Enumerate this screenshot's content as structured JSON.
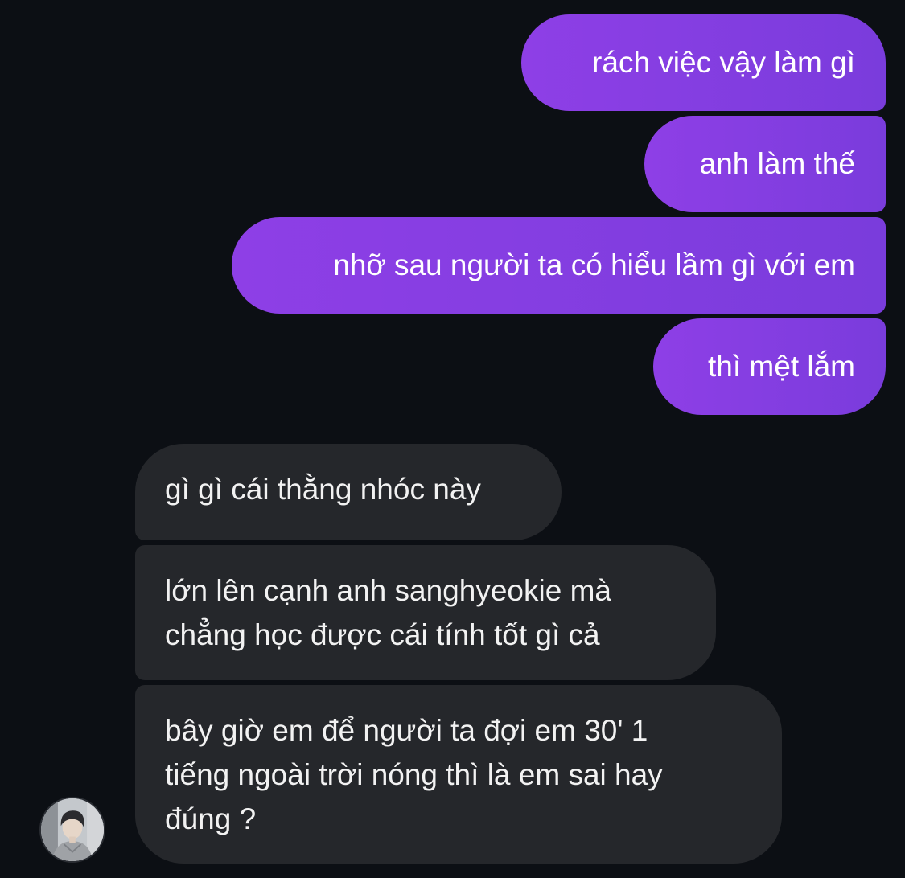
{
  "conversation": {
    "messages": [
      {
        "sender": "me",
        "text": "rách việc vậy làm gì"
      },
      {
        "sender": "me",
        "text": "anh làm thế"
      },
      {
        "sender": "me",
        "text": "nhỡ sau người ta có hiểu lầm gì với em"
      },
      {
        "sender": "me",
        "text": "thì mệt lắm"
      },
      {
        "sender": "other",
        "text": "gì gì cái thằng nhóc này"
      },
      {
        "sender": "other",
        "text": "lớn lên cạnh anh sanghyeokie mà chẳng học được cái tính tốt gì cả",
        "lines": [
          "lớn lên cạnh anh sanghyeokie mà",
          "chẳng học được cái tính tốt gì cả"
        ]
      },
      {
        "sender": "other",
        "text": "bây giờ em để người ta đợi em 30' 1 tiếng ngoài trời nóng thì là em sai hay đúng ?",
        "lines": [
          "bây giờ em để người ta đợi em 30' 1",
          "tiếng ngoài trời nóng thì là em sai hay",
          "đúng ?"
        ]
      }
    ]
  },
  "colors": {
    "background": "#0c0f14",
    "outgoing_bubble_start": "#8e3fe6",
    "outgoing_bubble_end": "#7a3cdc",
    "incoming_bubble": "#25272b",
    "text": "#ffffff"
  },
  "avatar": {
    "icon": "profile-photo"
  }
}
